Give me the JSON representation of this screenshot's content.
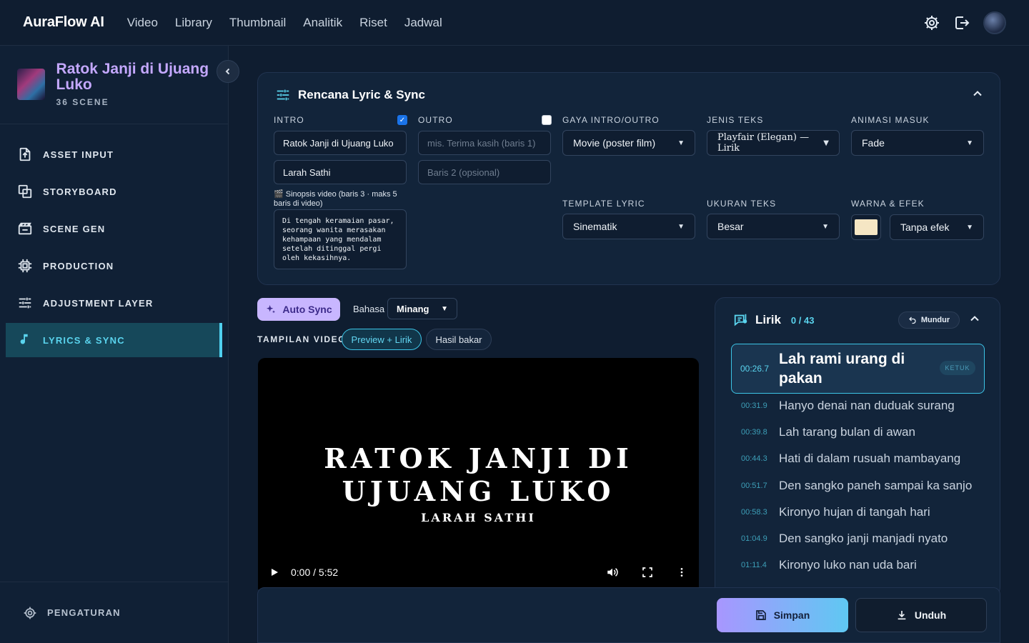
{
  "app": {
    "brand": "AuraFlow AI"
  },
  "nav": [
    "Video",
    "Library",
    "Thumbnail",
    "Analitik",
    "Riset",
    "Jadwal"
  ],
  "project": {
    "title": "Ratok Janji di Ujuang Luko",
    "scenes": "36 SCENE"
  },
  "sidebar": {
    "items": [
      {
        "label": "ASSET INPUT",
        "icon": "file-upload-icon"
      },
      {
        "label": "STORYBOARD",
        "icon": "layers-icon"
      },
      {
        "label": "SCENE GEN",
        "icon": "clapperboard-icon"
      },
      {
        "label": "PRODUCTION",
        "icon": "chip-icon"
      },
      {
        "label": "ADJUSTMENT LAYER",
        "icon": "sliders-icon"
      },
      {
        "label": "LYRICS & SYNC",
        "icon": "music-note-icon",
        "active": true
      }
    ],
    "settings": "PENGATURAN"
  },
  "plan": {
    "title": "Rencana Lyric & Sync",
    "intro": {
      "label": "INTRO",
      "checked": true,
      "line1": "Ratok Janji di Ujuang Luko",
      "line2": "Larah Sathi"
    },
    "outro": {
      "label": "OUTRO",
      "checked": false,
      "placeholder1": "mis. Terima kasih (baris 1)",
      "placeholder2": "Baris 2 (opsional)"
    },
    "synopsis_label": "🎬 Sinopsis video (baris 3 · maks 5 baris di video)",
    "synopsis": "Di tengah keramaian pasar, seorang wanita merasakan kehampaan yang mendalam setelah ditinggal pergi oleh kekasihnya.",
    "gaya": {
      "label": "GAYA INTRO/OUTRO",
      "value": "Movie (poster film)"
    },
    "jenis": {
      "label": "JENIS TEKS",
      "value": "Playfair (Elegan) — Lirik"
    },
    "animasi": {
      "label": "ANIMASI MASUK",
      "value": "Fade"
    },
    "template": {
      "label": "TEMPLATE LYRIC",
      "value": "Sinematik"
    },
    "ukuran": {
      "label": "UKURAN TEKS",
      "value": "Besar"
    },
    "warna": {
      "label": "WARNA & EFEK",
      "color": "#f5e6c4",
      "value": "Tanpa efek"
    }
  },
  "controls": {
    "auto_sync": "Auto Sync",
    "bahasa_label": "Bahasa",
    "bahasa": "Minang",
    "tampilan_label": "TAMPILAN VIDEO",
    "preview": "Preview + Lirik",
    "hasil": "Hasil bakar"
  },
  "video": {
    "title": "RATOK JANJI DI UJUANG LUKO",
    "artist": "LARAH SATHI",
    "time": "0:00 / 5:52"
  },
  "lyrics": {
    "title": "Lirik",
    "count": "0 / 43",
    "mundur": "Mundur",
    "active": {
      "time": "00:26.7",
      "text": "Lah rami urang di pakan",
      "badge": "KETUK"
    },
    "rows": [
      {
        "time": "00:31.9",
        "text": "Hanyo denai nan duduak surang"
      },
      {
        "time": "00:39.8",
        "text": "Lah tarang bulan di awan"
      },
      {
        "time": "00:44.3",
        "text": "Hati di dalam rusuah mambayang"
      },
      {
        "time": "00:51.7",
        "text": "Den sangko paneh sampai ka sanjo"
      },
      {
        "time": "00:58.3",
        "text": "Kironyo hujan di tangah hari"
      },
      {
        "time": "01:04.9",
        "text": "Den sangko janji manjadi nyato"
      },
      {
        "time": "01:11.4",
        "text": "Kironyo luko nan uda bari"
      }
    ]
  },
  "footer": {
    "simpan": "Simpan",
    "unduh": "Unduh"
  }
}
